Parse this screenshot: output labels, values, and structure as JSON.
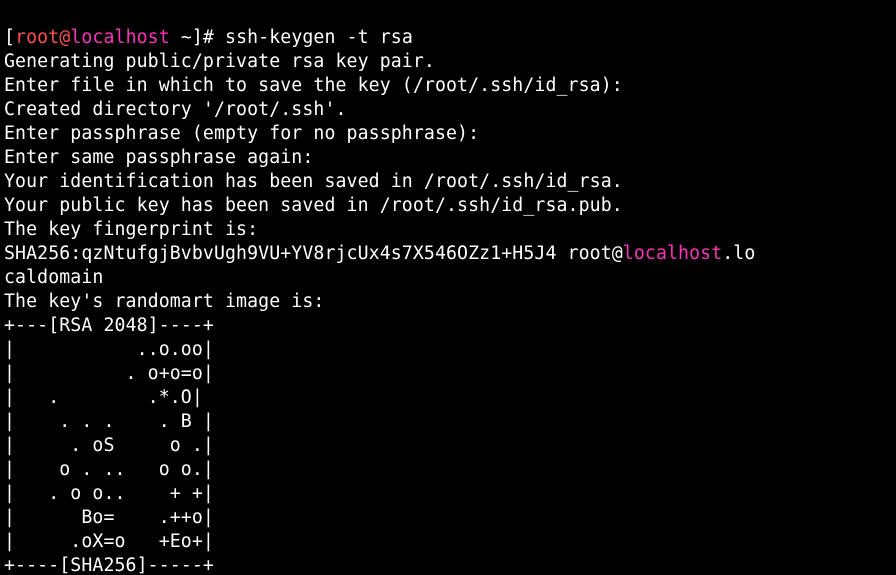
{
  "prompt": {
    "open": "[",
    "user": "root",
    "at": "@",
    "host": "localhost",
    "rest": " ~]# ",
    "command": "ssh-keygen -t rsa"
  },
  "lines": {
    "l1": "Generating public/private rsa key pair.",
    "l2": "Enter file in which to save the key (/root/.ssh/id_rsa):",
    "l3": "Created directory '/root/.ssh'.",
    "l4": "Enter passphrase (empty for no passphrase):",
    "l5": "Enter same passphrase again:",
    "l6": "Your identification has been saved in /root/.ssh/id_rsa.",
    "l7": "Your public key has been saved in /root/.ssh/id_rsa.pub.",
    "l8": "The key fingerprint is:",
    "fp_pre": "SHA256:qzNtufgjBvbvUgh9VU+YV8rjcUx4s7X546OZz1+H5J4 root@",
    "fp_host": "localhost",
    "fp_post": ".lo",
    "l10": "caldomain",
    "l11": "The key's randomart image is:",
    "art0": "+---[RSA 2048]----+",
    "art1": "|           ..o.oo|",
    "art2": "|          . o+o=o|",
    "art3": "|   .        .*.O|",
    "art4": "|    . . .    . B |",
    "art5": "|     . oS     o .|",
    "art6": "|    o . ..   o o.|",
    "art7": "|   . o o..    + +|",
    "art8": "|      Bo=    .++o|",
    "art9": "|     .oX=o   +Eo+|",
    "art10": "+----[SHA256]-----+"
  }
}
